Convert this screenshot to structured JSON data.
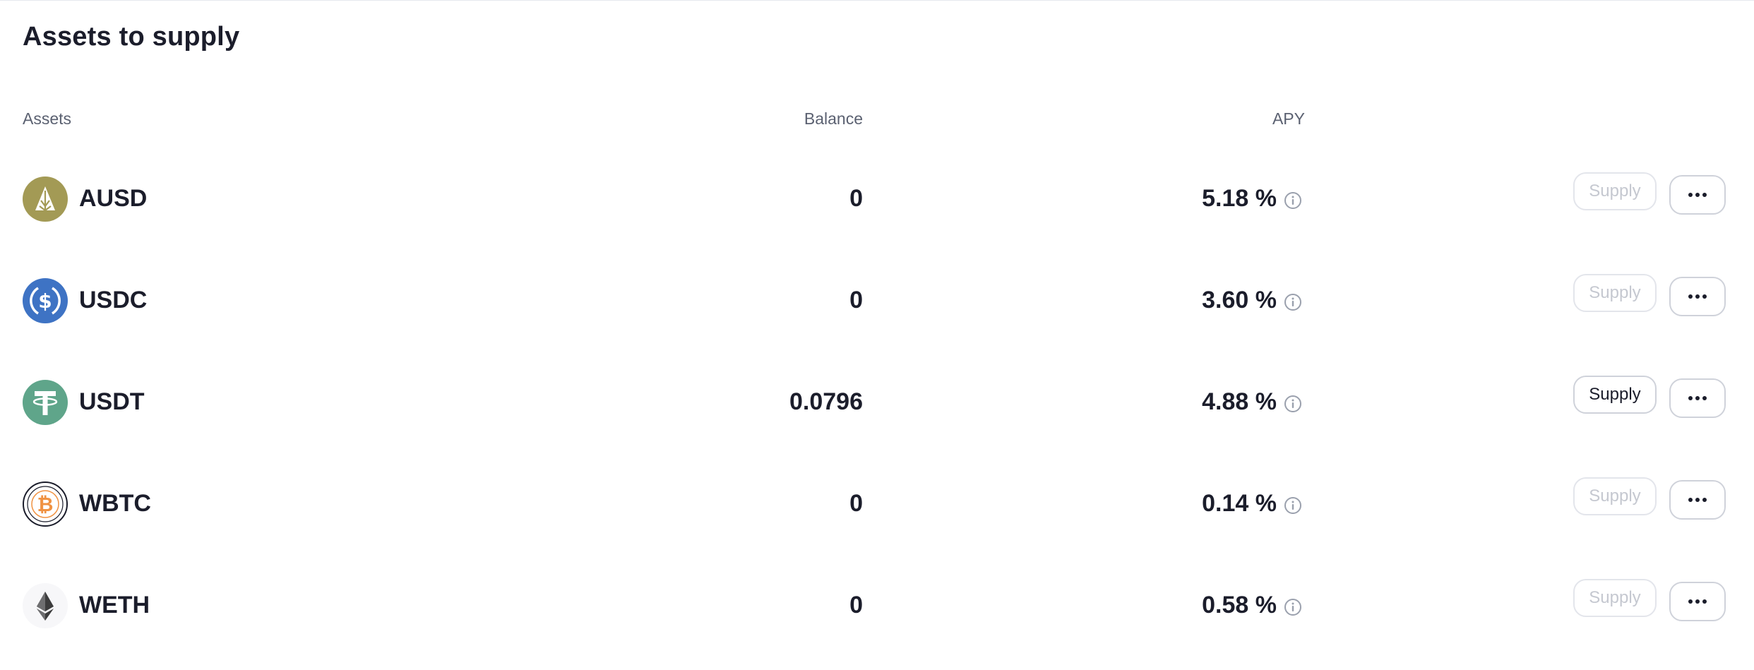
{
  "title": "Assets to supply",
  "headers": {
    "assets": "Assets",
    "balance": "Balance",
    "apy": "APY"
  },
  "rows": [
    {
      "symbol": "AUSD",
      "balance": "0",
      "apy": "5.18 %",
      "supply_label": "Supply",
      "supply_enabled": false,
      "icon": "ausd-icon"
    },
    {
      "symbol": "USDC",
      "balance": "0",
      "apy": "3.60 %",
      "supply_label": "Supply",
      "supply_enabled": false,
      "icon": "usdc-icon"
    },
    {
      "symbol": "USDT",
      "balance": "0.0796",
      "apy": "4.88 %",
      "supply_label": "Supply",
      "supply_enabled": true,
      "icon": "usdt-icon"
    },
    {
      "symbol": "WBTC",
      "balance": "0",
      "apy": "0.14 %",
      "supply_label": "Supply",
      "supply_enabled": false,
      "icon": "wbtc-icon"
    },
    {
      "symbol": "WETH",
      "balance": "0",
      "apy": "0.58 %",
      "supply_label": "Supply",
      "supply_enabled": false,
      "icon": "weth-icon"
    }
  ],
  "colors": {
    "ausd": "#a39a55",
    "usdc": "#3e73c4",
    "usdt": "#5fa58a",
    "wbtc_orange": "#f09242",
    "text": "#1b1d2b",
    "muted": "#5b6171",
    "disabled": "#c5c8d0"
  }
}
